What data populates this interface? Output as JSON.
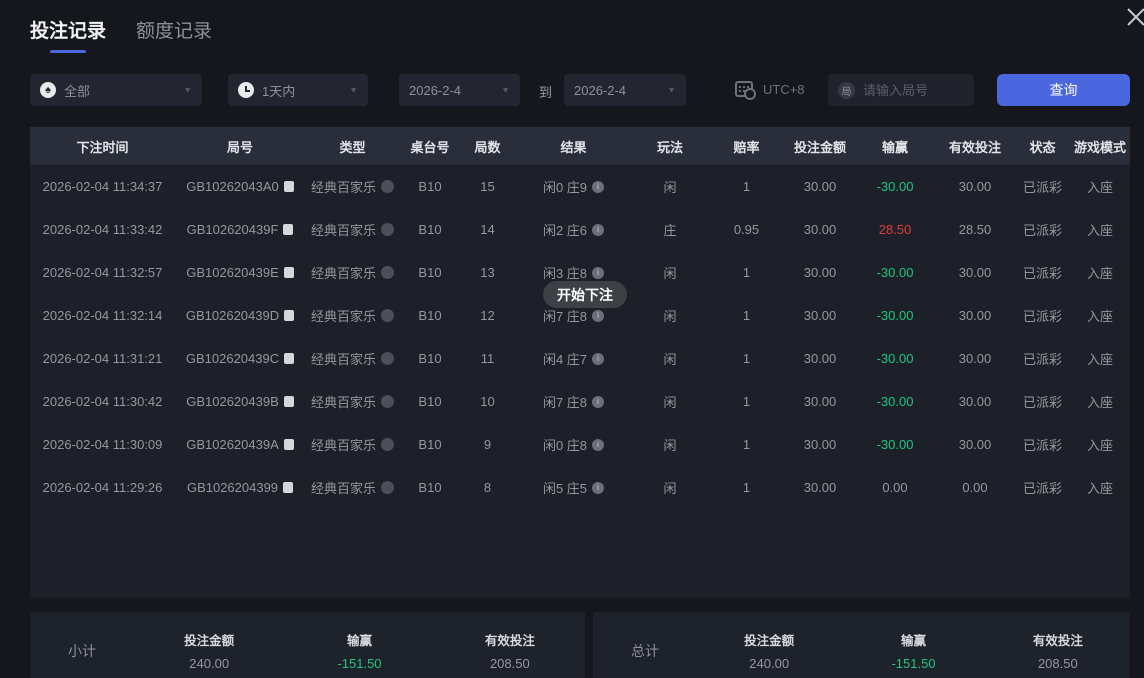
{
  "colors": {
    "accent": "#4a67e0",
    "profit": "#e23c3c",
    "loss": "#1ec77d"
  },
  "tabs": [
    {
      "label": "投注记录",
      "active": true
    },
    {
      "label": "额度记录",
      "active": false
    }
  ],
  "filters": {
    "game_type": {
      "value": "全部",
      "icon": "spade-icon",
      "icon_glyph": "♠"
    },
    "time_range": {
      "value": "1天内",
      "icon": "clock-icon"
    },
    "date_from": "2026-2-4",
    "to_label": "到",
    "date_to": "2026-2-4",
    "timezone": "UTC+8",
    "round_input": {
      "placeholder": "请输入局号",
      "icon_glyph": "局"
    },
    "query_button": "查询"
  },
  "toast": "开始下注",
  "table": {
    "headers": [
      "下注时间",
      "局号",
      "类型",
      "桌台号",
      "局数",
      "结果",
      "玩法",
      "赔率",
      "投注金额",
      "输赢",
      "有效投注",
      "状态",
      "游戏模式"
    ],
    "rows": [
      {
        "time": "2026-02-04 11:34:37",
        "round_id": "GB10262043A0",
        "type": "经典百家乐",
        "table_no": "B10",
        "round_no": "15",
        "result": "闲0 庄9",
        "play": "闲",
        "odds": "1",
        "bet": "30.00",
        "win_loss": "-30.00",
        "win_loss_color": "green",
        "valid_bet": "30.00",
        "status": "已派彩",
        "mode": "入座"
      },
      {
        "time": "2026-02-04 11:33:42",
        "round_id": "GB102620439F",
        "type": "经典百家乐",
        "table_no": "B10",
        "round_no": "14",
        "result": "闲2 庄6",
        "play": "庄",
        "odds": "0.95",
        "bet": "30.00",
        "win_loss": "28.50",
        "win_loss_color": "red",
        "valid_bet": "28.50",
        "status": "已派彩",
        "mode": "入座"
      },
      {
        "time": "2026-02-04 11:32:57",
        "round_id": "GB102620439E",
        "type": "经典百家乐",
        "table_no": "B10",
        "round_no": "13",
        "result": "闲3 庄8",
        "play": "闲",
        "odds": "1",
        "bet": "30.00",
        "win_loss": "-30.00",
        "win_loss_color": "green",
        "valid_bet": "30.00",
        "status": "已派彩",
        "mode": "入座"
      },
      {
        "time": "2026-02-04 11:32:14",
        "round_id": "GB102620439D",
        "type": "经典百家乐",
        "table_no": "B10",
        "round_no": "12",
        "result": "闲7 庄8",
        "play": "闲",
        "odds": "1",
        "bet": "30.00",
        "win_loss": "-30.00",
        "win_loss_color": "green",
        "valid_bet": "30.00",
        "status": "已派彩",
        "mode": "入座"
      },
      {
        "time": "2026-02-04 11:31:21",
        "round_id": "GB102620439C",
        "type": "经典百家乐",
        "table_no": "B10",
        "round_no": "11",
        "result": "闲4 庄7",
        "play": "闲",
        "odds": "1",
        "bet": "30.00",
        "win_loss": "-30.00",
        "win_loss_color": "green",
        "valid_bet": "30.00",
        "status": "已派彩",
        "mode": "入座"
      },
      {
        "time": "2026-02-04 11:30:42",
        "round_id": "GB102620439B",
        "type": "经典百家乐",
        "table_no": "B10",
        "round_no": "10",
        "result": "闲7 庄8",
        "play": "闲",
        "odds": "1",
        "bet": "30.00",
        "win_loss": "-30.00",
        "win_loss_color": "green",
        "valid_bet": "30.00",
        "status": "已派彩",
        "mode": "入座"
      },
      {
        "time": "2026-02-04 11:30:09",
        "round_id": "GB102620439A",
        "type": "经典百家乐",
        "table_no": "B10",
        "round_no": "9",
        "result": "闲0 庄8",
        "play": "闲",
        "odds": "1",
        "bet": "30.00",
        "win_loss": "-30.00",
        "win_loss_color": "green",
        "valid_bet": "30.00",
        "status": "已派彩",
        "mode": "入座"
      },
      {
        "time": "2026-02-04 11:29:26",
        "round_id": "GB1026204399",
        "type": "经典百家乐",
        "table_no": "B10",
        "round_no": "8",
        "result": "闲5 庄5",
        "play": "闲",
        "odds": "1",
        "bet": "30.00",
        "win_loss": "0.00",
        "win_loss_color": "gray",
        "valid_bet": "0.00",
        "status": "已派彩",
        "mode": "入座"
      }
    ]
  },
  "summary": {
    "subtotal": {
      "label": "小计",
      "items": [
        {
          "label": "投注金额",
          "value": "240.00",
          "color": "gray"
        },
        {
          "label": "输赢",
          "value": "-151.50",
          "color": "green"
        },
        {
          "label": "有效投注",
          "value": "208.50",
          "color": "gray"
        }
      ]
    },
    "total": {
      "label": "总计",
      "items": [
        {
          "label": "投注金额",
          "value": "240.00",
          "color": "gray"
        },
        {
          "label": "输赢",
          "value": "-151.50",
          "color": "green"
        },
        {
          "label": "有效投注",
          "value": "208.50",
          "color": "gray"
        }
      ]
    }
  }
}
